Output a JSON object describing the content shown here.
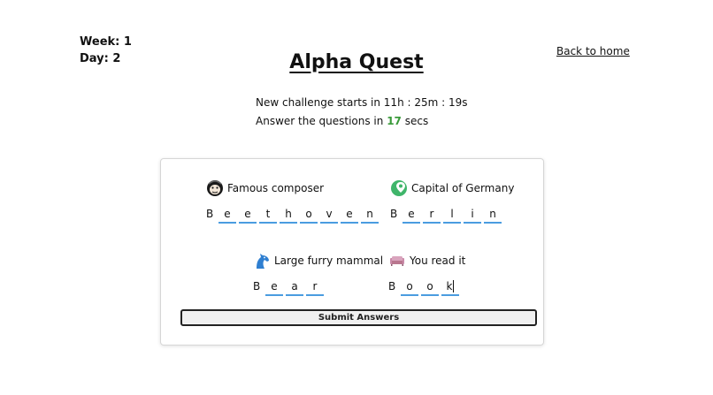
{
  "header": {
    "week_label": "Week: 1",
    "day_label": "Day: 2",
    "title": "Alpha Quest",
    "back_link": "Back to home"
  },
  "info": {
    "countdown_prefix": "New challenge starts in ",
    "countdown_value": "11h : 25m : 19s",
    "answer_prefix": "Answer the questions in ",
    "answer_secs": "17",
    "answer_suffix": " secs"
  },
  "questions": [
    {
      "icon": "monkey-icon",
      "label": "Famous composer",
      "answer": [
        "B",
        "e",
        "e",
        "t",
        "h",
        "o",
        "v",
        "e",
        "n"
      ]
    },
    {
      "icon": "map-pin-icon",
      "label": "Capital of Germany",
      "answer": [
        "B",
        "e",
        "r",
        "l",
        "i",
        "n"
      ]
    },
    {
      "icon": "horse-icon",
      "label": "Large furry mammal",
      "answer": [
        "B",
        "e",
        "a",
        "r"
      ]
    },
    {
      "icon": "sofa-icon",
      "label": "You read it",
      "answer": [
        "B",
        "o",
        "o",
        "k"
      ]
    }
  ],
  "submit_label": "Submit Answers",
  "colors": {
    "accent": "#4a9ce0",
    "timer": "#3a9a3a"
  }
}
